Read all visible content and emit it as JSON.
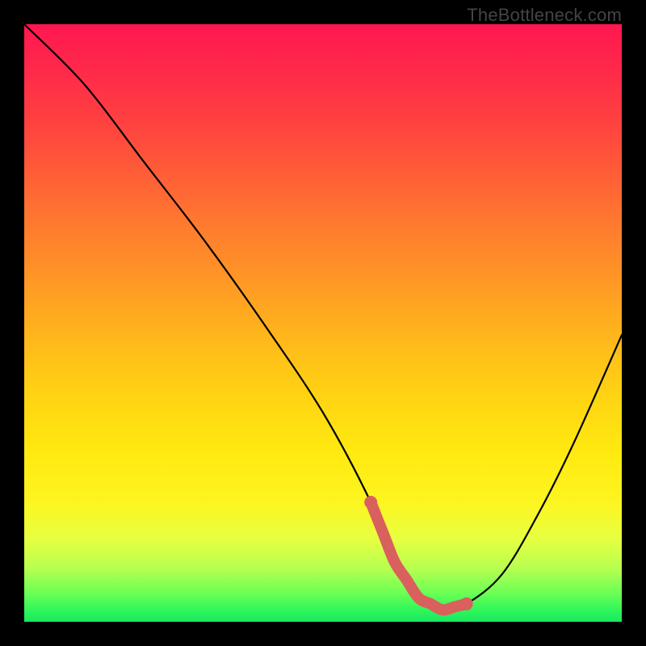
{
  "watermark": "TheBottleneck.com",
  "chart_data": {
    "type": "line",
    "title": "",
    "xlabel": "",
    "ylabel": "",
    "xlim": [
      0,
      100
    ],
    "ylim": [
      0,
      100
    ],
    "series": [
      {
        "name": "bottleneck-curve",
        "x": [
          0,
          10,
          20,
          30,
          40,
          50,
          58,
          62,
          66,
          70,
          74,
          80,
          86,
          92,
          100
        ],
        "values": [
          100,
          90,
          77,
          64,
          50,
          35,
          20,
          10,
          4,
          2,
          3,
          8,
          18,
          30,
          48
        ]
      }
    ],
    "highlight_range": {
      "x_start": 58,
      "x_end": 74,
      "color": "#d9605c"
    },
    "gradient_stops": [
      {
        "pos": 0,
        "color": "#ff1750"
      },
      {
        "pos": 50,
        "color": "#ffb020"
      },
      {
        "pos": 80,
        "color": "#fff010"
      },
      {
        "pos": 100,
        "color": "#18e860"
      }
    ],
    "grid": false,
    "legend": false
  }
}
